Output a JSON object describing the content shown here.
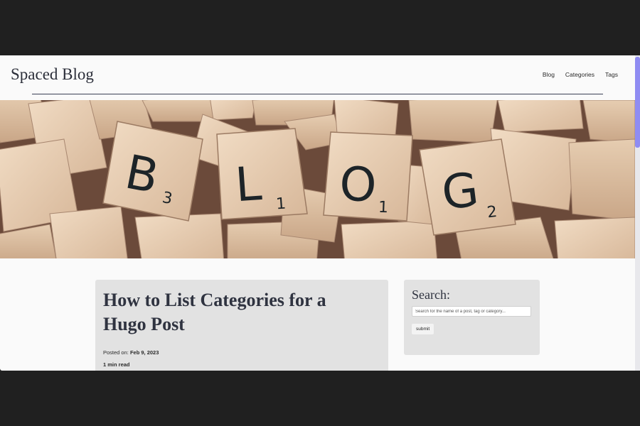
{
  "header": {
    "site_title": "Spaced Blog",
    "nav": [
      {
        "label": "Blog"
      },
      {
        "label": "Categories"
      },
      {
        "label": "Tags"
      }
    ]
  },
  "hero": {
    "tiles": [
      {
        "letter": "B",
        "subscript": "3"
      },
      {
        "letter": "L",
        "subscript": "1"
      },
      {
        "letter": "O",
        "subscript": "1"
      },
      {
        "letter": "G",
        "subscript": "2"
      }
    ]
  },
  "post": {
    "title": "How to List Categories for a Hugo Post",
    "posted_label": "Posted on:",
    "date": "Feb 9, 2023",
    "read_time": "1 min read"
  },
  "search": {
    "heading": "Search:",
    "placeholder": "Search for the name of a post, tag or category...",
    "submit_label": "submit"
  },
  "colors": {
    "window_bg": "#202020",
    "page_bg": "#fafafa",
    "card_bg": "#e2e2e2",
    "scrollbar_thumb": "#8f8cf2"
  }
}
